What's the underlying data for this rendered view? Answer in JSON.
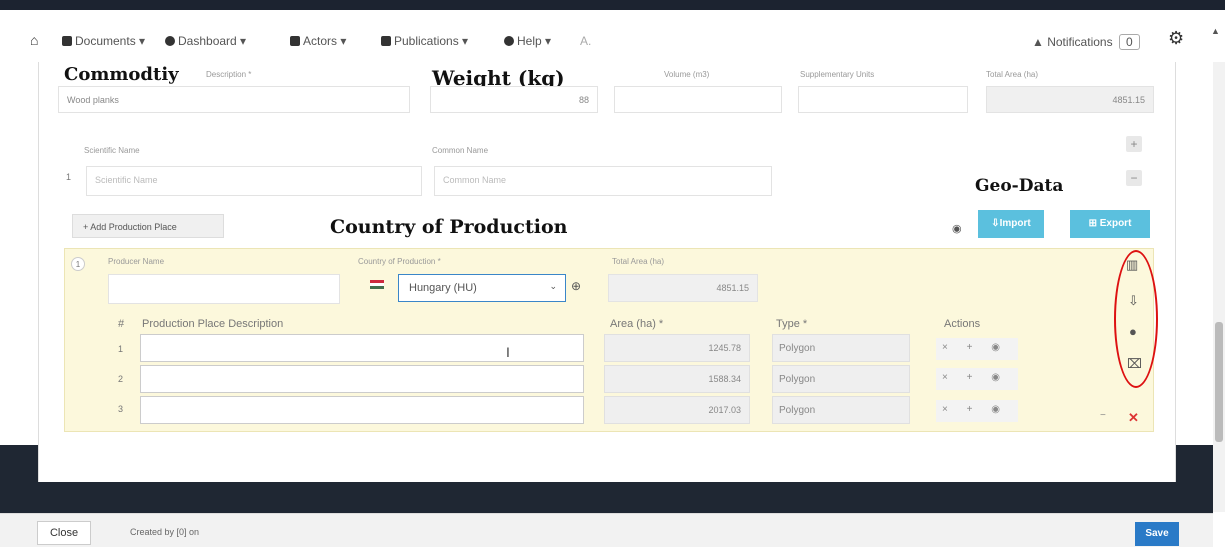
{
  "nav": {
    "home_icon": "⌂",
    "items": [
      {
        "label": "Documents ▾",
        "icon": "document-icon"
      },
      {
        "label": "Dashboard ▾",
        "icon": "dashboard-icon"
      },
      {
        "label": "Actors ▾",
        "icon": "actors-icon"
      },
      {
        "label": "Publications ▾",
        "icon": "publications-icon"
      },
      {
        "label": "Help ▾",
        "icon": "help-icon"
      }
    ],
    "truncated": "A.",
    "notifications_label": "Notifications",
    "notifications_count": "0",
    "user_icon": "user-gear-icon"
  },
  "annotations": {
    "commodity": "Commodtiy",
    "weight": "Weight (kg)",
    "country": "Country of Production",
    "geo": "Geo-Data"
  },
  "commodity": {
    "description_label": "Description *",
    "description_value": "Wood planks",
    "weight_value": "88",
    "volume_label": "Volume (m3)",
    "supp_label": "Supplementary Units",
    "total_area_label": "Total Area (ha)",
    "total_area_value": "4851.15"
  },
  "species": {
    "scientific_label": "Scientific Name",
    "common_label": "Common Name",
    "row_index": "1",
    "scientific_placeholder": "Scientific Name",
    "common_placeholder": "Common Name"
  },
  "buttons": {
    "add_production_place": "+ Add Production Place",
    "import": "⇩Import",
    "export": "⊞ Export",
    "close": "Close",
    "save": "Save"
  },
  "production": {
    "index": "1",
    "producer_label": "Producer Name",
    "country_label": "Country of Production *",
    "country_value": "Hungary (HU)",
    "total_area_label": "Total Area (ha)",
    "total_area_value": "4851.15",
    "flag_colors": [
      "#cd2a3e",
      "#ffffff",
      "#436f4d"
    ],
    "table_headers": {
      "num": "#",
      "desc": "Production Place Description",
      "area": "Area (ha) *",
      "type": "Type *",
      "actions": "Actions"
    },
    "rows": [
      {
        "num": "1",
        "area": "1245.78",
        "type": "Polygon"
      },
      {
        "num": "2",
        "area": "1588.34",
        "type": "Polygon"
      },
      {
        "num": "3",
        "area": "2017.03",
        "type": "Polygon"
      }
    ],
    "row_actions": "× + ◉"
  },
  "footer": {
    "created": "Created by [0] on"
  }
}
